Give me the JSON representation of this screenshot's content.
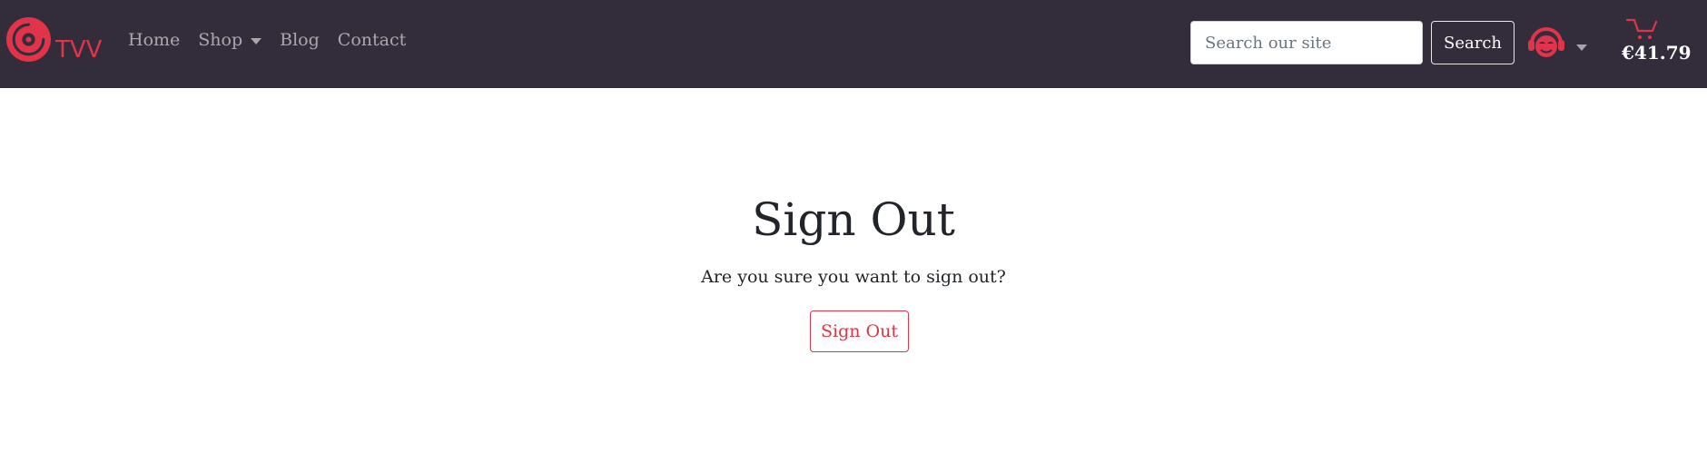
{
  "brand": {
    "name": "TVV",
    "icon": "vinyl-record-icon"
  },
  "nav": {
    "items": [
      {
        "label": "Home"
      },
      {
        "label": "Shop",
        "has_dropdown": true
      },
      {
        "label": "Blog"
      },
      {
        "label": "Contact"
      }
    ]
  },
  "search": {
    "placeholder": "Search our site",
    "value": "",
    "button_label": "Search"
  },
  "account": {
    "icon": "account-avatar-icon",
    "has_dropdown": true
  },
  "cart": {
    "icon": "shopping-cart-icon",
    "total": "€41.79"
  },
  "main": {
    "title": "Sign Out",
    "message": "Are you sure you want to sign out?",
    "button_label": "Sign Out"
  },
  "colors": {
    "navbar_bg": "#332d3b",
    "accent": "#e1334a",
    "danger": "#dc3545",
    "nav_text": "rgba(255,255,255,0.58)"
  }
}
